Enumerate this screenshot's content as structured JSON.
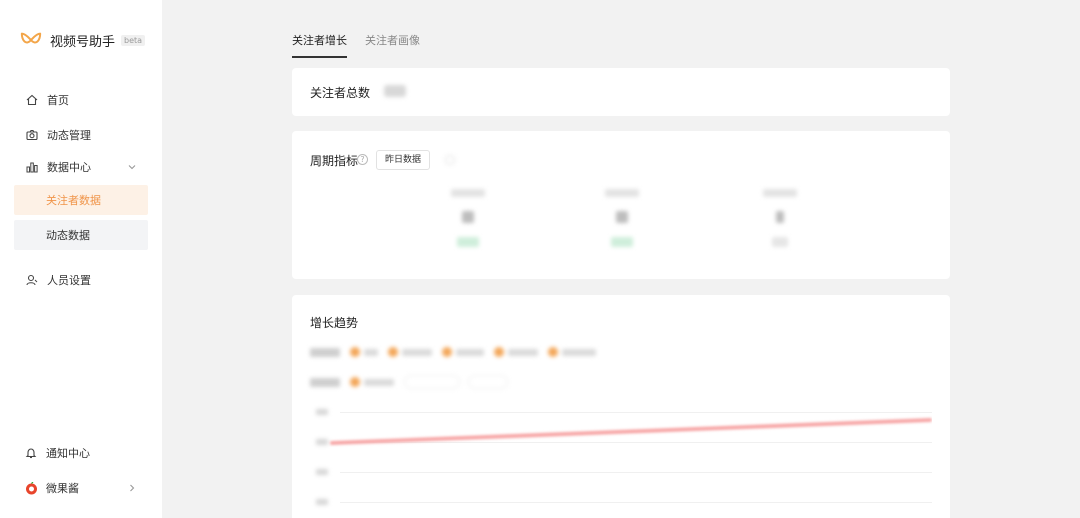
{
  "app": {
    "title": "视频号助手",
    "badge": "beta"
  },
  "sidebar": {
    "items": [
      {
        "label": "首页",
        "icon": "home-icon"
      },
      {
        "label": "动态管理",
        "icon": "camera-icon"
      },
      {
        "label": "数据中心",
        "icon": "bar-chart-icon"
      },
      {
        "label": "人员设置",
        "icon": "user-settings-icon"
      }
    ],
    "subitems": [
      {
        "label": "关注者数据",
        "state": "active"
      },
      {
        "label": "动态数据",
        "state": "hover"
      }
    ],
    "bottom": [
      {
        "label": "通知中心",
        "icon": "bell-icon"
      },
      {
        "label": "微果酱",
        "icon": "account-avatar-icon"
      }
    ],
    "accent_color": "#f0954a"
  },
  "tabs": [
    {
      "label": "关注者增长",
      "active": true
    },
    {
      "label": "关注者画像",
      "active": false
    }
  ],
  "total_card": {
    "title": "关注者总数"
  },
  "period_card": {
    "title": "周期指标",
    "yesterday_button": "昨日数据"
  },
  "trend_card": {
    "title": "增长趋势"
  },
  "colors": {
    "positive_change": "#c6ecd3",
    "trend_line": "#f7a8a8",
    "filter_dot": "#f3a658"
  }
}
